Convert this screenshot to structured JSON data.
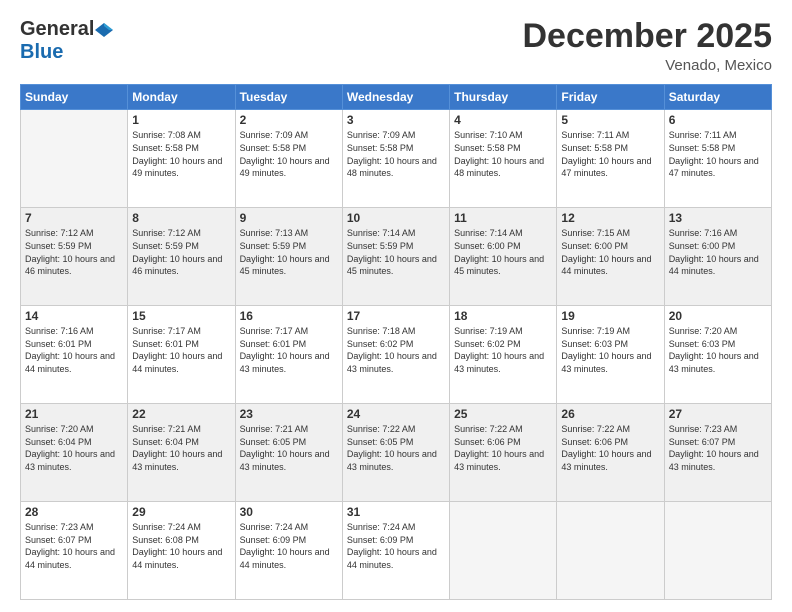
{
  "logo": {
    "general": "General",
    "blue": "Blue"
  },
  "title": "December 2025",
  "location": "Venado, Mexico",
  "days_of_week": [
    "Sunday",
    "Monday",
    "Tuesday",
    "Wednesday",
    "Thursday",
    "Friday",
    "Saturday"
  ],
  "weeks": [
    {
      "shade": false,
      "days": [
        {
          "num": "",
          "empty": true,
          "sunrise": "",
          "sunset": "",
          "daylight": ""
        },
        {
          "num": "1",
          "empty": false,
          "sunrise": "Sunrise: 7:08 AM",
          "sunset": "Sunset: 5:58 PM",
          "daylight": "Daylight: 10 hours and 49 minutes."
        },
        {
          "num": "2",
          "empty": false,
          "sunrise": "Sunrise: 7:09 AM",
          "sunset": "Sunset: 5:58 PM",
          "daylight": "Daylight: 10 hours and 49 minutes."
        },
        {
          "num": "3",
          "empty": false,
          "sunrise": "Sunrise: 7:09 AM",
          "sunset": "Sunset: 5:58 PM",
          "daylight": "Daylight: 10 hours and 48 minutes."
        },
        {
          "num": "4",
          "empty": false,
          "sunrise": "Sunrise: 7:10 AM",
          "sunset": "Sunset: 5:58 PM",
          "daylight": "Daylight: 10 hours and 48 minutes."
        },
        {
          "num": "5",
          "empty": false,
          "sunrise": "Sunrise: 7:11 AM",
          "sunset": "Sunset: 5:58 PM",
          "daylight": "Daylight: 10 hours and 47 minutes."
        },
        {
          "num": "6",
          "empty": false,
          "sunrise": "Sunrise: 7:11 AM",
          "sunset": "Sunset: 5:58 PM",
          "daylight": "Daylight: 10 hours and 47 minutes."
        }
      ]
    },
    {
      "shade": true,
      "days": [
        {
          "num": "7",
          "empty": false,
          "sunrise": "Sunrise: 7:12 AM",
          "sunset": "Sunset: 5:59 PM",
          "daylight": "Daylight: 10 hours and 46 minutes."
        },
        {
          "num": "8",
          "empty": false,
          "sunrise": "Sunrise: 7:12 AM",
          "sunset": "Sunset: 5:59 PM",
          "daylight": "Daylight: 10 hours and 46 minutes."
        },
        {
          "num": "9",
          "empty": false,
          "sunrise": "Sunrise: 7:13 AM",
          "sunset": "Sunset: 5:59 PM",
          "daylight": "Daylight: 10 hours and 45 minutes."
        },
        {
          "num": "10",
          "empty": false,
          "sunrise": "Sunrise: 7:14 AM",
          "sunset": "Sunset: 5:59 PM",
          "daylight": "Daylight: 10 hours and 45 minutes."
        },
        {
          "num": "11",
          "empty": false,
          "sunrise": "Sunrise: 7:14 AM",
          "sunset": "Sunset: 6:00 PM",
          "daylight": "Daylight: 10 hours and 45 minutes."
        },
        {
          "num": "12",
          "empty": false,
          "sunrise": "Sunrise: 7:15 AM",
          "sunset": "Sunset: 6:00 PM",
          "daylight": "Daylight: 10 hours and 44 minutes."
        },
        {
          "num": "13",
          "empty": false,
          "sunrise": "Sunrise: 7:16 AM",
          "sunset": "Sunset: 6:00 PM",
          "daylight": "Daylight: 10 hours and 44 minutes."
        }
      ]
    },
    {
      "shade": false,
      "days": [
        {
          "num": "14",
          "empty": false,
          "sunrise": "Sunrise: 7:16 AM",
          "sunset": "Sunset: 6:01 PM",
          "daylight": "Daylight: 10 hours and 44 minutes."
        },
        {
          "num": "15",
          "empty": false,
          "sunrise": "Sunrise: 7:17 AM",
          "sunset": "Sunset: 6:01 PM",
          "daylight": "Daylight: 10 hours and 44 minutes."
        },
        {
          "num": "16",
          "empty": false,
          "sunrise": "Sunrise: 7:17 AM",
          "sunset": "Sunset: 6:01 PM",
          "daylight": "Daylight: 10 hours and 43 minutes."
        },
        {
          "num": "17",
          "empty": false,
          "sunrise": "Sunrise: 7:18 AM",
          "sunset": "Sunset: 6:02 PM",
          "daylight": "Daylight: 10 hours and 43 minutes."
        },
        {
          "num": "18",
          "empty": false,
          "sunrise": "Sunrise: 7:19 AM",
          "sunset": "Sunset: 6:02 PM",
          "daylight": "Daylight: 10 hours and 43 minutes."
        },
        {
          "num": "19",
          "empty": false,
          "sunrise": "Sunrise: 7:19 AM",
          "sunset": "Sunset: 6:03 PM",
          "daylight": "Daylight: 10 hours and 43 minutes."
        },
        {
          "num": "20",
          "empty": false,
          "sunrise": "Sunrise: 7:20 AM",
          "sunset": "Sunset: 6:03 PM",
          "daylight": "Daylight: 10 hours and 43 minutes."
        }
      ]
    },
    {
      "shade": true,
      "days": [
        {
          "num": "21",
          "empty": false,
          "sunrise": "Sunrise: 7:20 AM",
          "sunset": "Sunset: 6:04 PM",
          "daylight": "Daylight: 10 hours and 43 minutes."
        },
        {
          "num": "22",
          "empty": false,
          "sunrise": "Sunrise: 7:21 AM",
          "sunset": "Sunset: 6:04 PM",
          "daylight": "Daylight: 10 hours and 43 minutes."
        },
        {
          "num": "23",
          "empty": false,
          "sunrise": "Sunrise: 7:21 AM",
          "sunset": "Sunset: 6:05 PM",
          "daylight": "Daylight: 10 hours and 43 minutes."
        },
        {
          "num": "24",
          "empty": false,
          "sunrise": "Sunrise: 7:22 AM",
          "sunset": "Sunset: 6:05 PM",
          "daylight": "Daylight: 10 hours and 43 minutes."
        },
        {
          "num": "25",
          "empty": false,
          "sunrise": "Sunrise: 7:22 AM",
          "sunset": "Sunset: 6:06 PM",
          "daylight": "Daylight: 10 hours and 43 minutes."
        },
        {
          "num": "26",
          "empty": false,
          "sunrise": "Sunrise: 7:22 AM",
          "sunset": "Sunset: 6:06 PM",
          "daylight": "Daylight: 10 hours and 43 minutes."
        },
        {
          "num": "27",
          "empty": false,
          "sunrise": "Sunrise: 7:23 AM",
          "sunset": "Sunset: 6:07 PM",
          "daylight": "Daylight: 10 hours and 43 minutes."
        }
      ]
    },
    {
      "shade": false,
      "days": [
        {
          "num": "28",
          "empty": false,
          "sunrise": "Sunrise: 7:23 AM",
          "sunset": "Sunset: 6:07 PM",
          "daylight": "Daylight: 10 hours and 44 minutes."
        },
        {
          "num": "29",
          "empty": false,
          "sunrise": "Sunrise: 7:24 AM",
          "sunset": "Sunset: 6:08 PM",
          "daylight": "Daylight: 10 hours and 44 minutes."
        },
        {
          "num": "30",
          "empty": false,
          "sunrise": "Sunrise: 7:24 AM",
          "sunset": "Sunset: 6:09 PM",
          "daylight": "Daylight: 10 hours and 44 minutes."
        },
        {
          "num": "31",
          "empty": false,
          "sunrise": "Sunrise: 7:24 AM",
          "sunset": "Sunset: 6:09 PM",
          "daylight": "Daylight: 10 hours and 44 minutes."
        },
        {
          "num": "",
          "empty": true,
          "sunrise": "",
          "sunset": "",
          "daylight": ""
        },
        {
          "num": "",
          "empty": true,
          "sunrise": "",
          "sunset": "",
          "daylight": ""
        },
        {
          "num": "",
          "empty": true,
          "sunrise": "",
          "sunset": "",
          "daylight": ""
        }
      ]
    }
  ]
}
